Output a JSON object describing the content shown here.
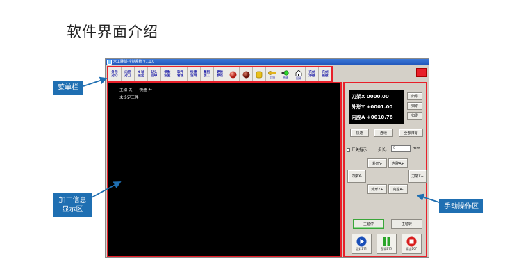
{
  "slide": {
    "title": "软件界面介绍"
  },
  "window": {
    "title": "木工雕刻·控制系统 V1.1.0",
    "toolbar": [
      {
        "label": "外形\n对刀"
      },
      {
        "label": "内腔\n对刀"
      },
      {
        "label": "X 轴\n设定"
      },
      {
        "label": "钻头\n回中"
      },
      {
        "label": "参数\n设置"
      },
      {
        "label": "软件\n管理"
      },
      {
        "label": "快捷\n说明"
      },
      {
        "label": "雕刻\n加工"
      },
      {
        "label": "更换\n参点"
      },
      {
        "icon": "red-sphere-icon"
      },
      {
        "icon": "dark-red-sphere-icon"
      },
      {
        "icon": "yellow-cylinder-icon"
      },
      {
        "icon": "golden-key-icon",
        "caption": "介绍"
      },
      {
        "icon": "green-led-icon",
        "caption": "急速"
      },
      {
        "icon": "house-icon",
        "caption": "回原"
      },
      {
        "label": "充剑\n添截"
      },
      {
        "label": "充剑\n画截"
      }
    ],
    "display": {
      "spindle_status": "主轴-关",
      "speed_status": "快速-开",
      "workpiece_status": "未设定工件"
    },
    "panel": {
      "coords": [
        {
          "label": "刀架X",
          "value": "0000.00",
          "zero_label": "归零"
        },
        {
          "label": "外形Y",
          "value": "+0001.00",
          "zero_label": "归零"
        },
        {
          "label": "内腔A",
          "value": "+0010.78",
          "zero_label": "归零"
        }
      ],
      "fast_label": "快速",
      "continuous_label": "连续",
      "all_zero_label": "全部归零",
      "switch_indicator_label": "开关指示",
      "step_label": "步长:",
      "step_value": "0",
      "step_unit": "mm",
      "jog": {
        "y_minus": "外形Y-",
        "a_plus": "内腔A+",
        "x_minus": "刀架X-",
        "x_plus": "刀架X+",
        "y_plus": "外形Y+",
        "a_minus": "内腔A-"
      },
      "spindle_stop_label": "主轴停",
      "spindle_run_label": "主轴转",
      "run_label": "运行F11",
      "pause_label": "暂停F12",
      "stop_label": "停止ESC"
    }
  },
  "callouts": {
    "menu_bar": "菜单栏",
    "info_display": "加工信息\n显示区",
    "manual_area": "手动操作区"
  },
  "colors": {
    "highlight": "#e8202a",
    "callout": "#1f6fb2"
  }
}
